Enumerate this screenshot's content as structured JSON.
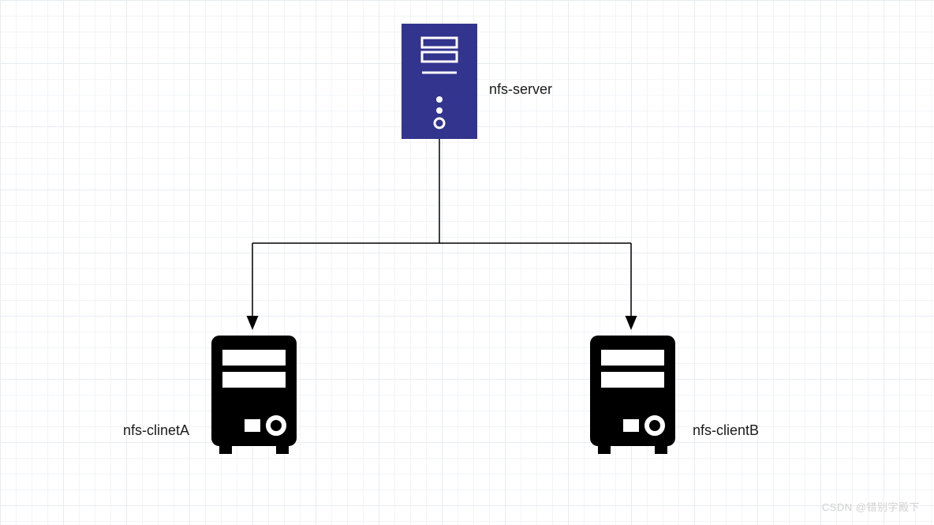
{
  "nodes": {
    "server": {
      "label": "nfs-server"
    },
    "clientA": {
      "label": "nfs-clinetA"
    },
    "clientB": {
      "label": "nfs-clientB"
    }
  },
  "watermark": "CSDN @错别字殿下",
  "colors": {
    "server_fill": "#33348e",
    "client_fill": "#000000",
    "grid_major": "#e8ecf0",
    "grid_minor": "#f2f4f7",
    "connector": "#000000"
  }
}
